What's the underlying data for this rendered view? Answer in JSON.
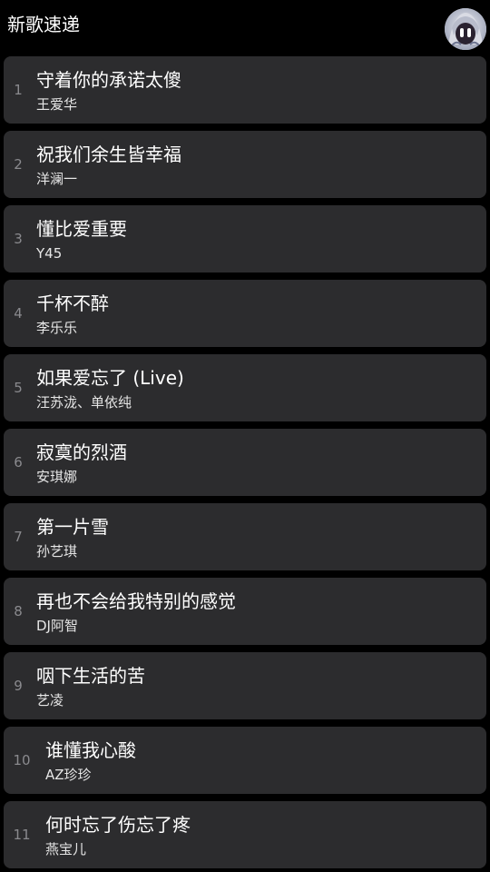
{
  "header": {
    "title": "新歌速递",
    "avatar_icon": "user-avatar"
  },
  "colors": {
    "background": "#000000",
    "card": "#2c2c2e",
    "index_text": "#8a8a8e",
    "title_text": "#ffffff",
    "artist_text": "#e6e6e6"
  },
  "songs": [
    {
      "index": "1",
      "title": "守着你的承诺太傻",
      "artist": "王爱华"
    },
    {
      "index": "2",
      "title": "祝我们余生皆幸福",
      "artist": "洋澜一"
    },
    {
      "index": "3",
      "title": "懂比爱重要",
      "artist": "Y45"
    },
    {
      "index": "4",
      "title": "千杯不醉",
      "artist": "李乐乐"
    },
    {
      "index": "5",
      "title": "如果爱忘了 (Live)",
      "artist": "汪苏泷、单依纯"
    },
    {
      "index": "6",
      "title": "寂寞的烈酒",
      "artist": "安琪娜"
    },
    {
      "index": "7",
      "title": "第一片雪",
      "artist": "孙艺琪"
    },
    {
      "index": "8",
      "title": "再也不会给我特别的感觉",
      "artist": "DJ阿智"
    },
    {
      "index": "9",
      "title": "咽下生活的苦",
      "artist": "艺凌"
    },
    {
      "index": "10",
      "title": "谁懂我心酸",
      "artist": "AZ珍珍"
    },
    {
      "index": "11",
      "title": "何时忘了伤忘了疼",
      "artist": "燕宝儿"
    }
  ]
}
